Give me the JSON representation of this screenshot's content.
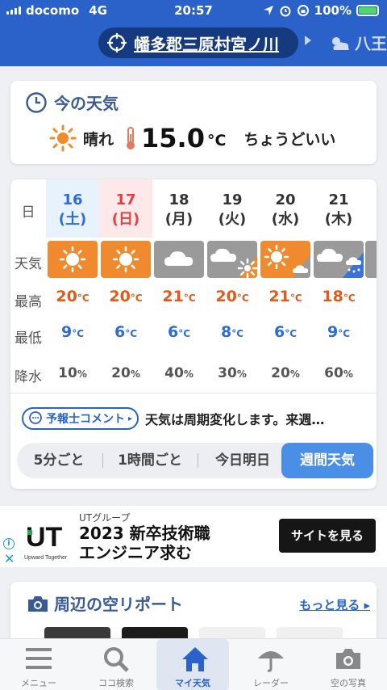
{
  "status": {
    "carrier": "docomo",
    "network": "4G",
    "time": "20:57",
    "battery": "100%"
  },
  "header": {
    "location": "幡多郡三原村宮ノ川",
    "next_location": "八王"
  },
  "now": {
    "title": "今の天気",
    "condition": "晴れ",
    "temp": "15.0",
    "unit": "°C",
    "feel": "ちょうどいい"
  },
  "week": {
    "row_labels": {
      "day": "日",
      "weather": "天気",
      "high": "最高",
      "low": "最低",
      "rain": "降水"
    },
    "days": [
      {
        "date": "16",
        "dow": "(土)",
        "weather": "sunny",
        "high": "20",
        "low": "9",
        "rain": "10"
      },
      {
        "date": "17",
        "dow": "(日)",
        "weather": "sunny",
        "high": "20",
        "low": "6",
        "rain": "20"
      },
      {
        "date": "18",
        "dow": "(月)",
        "weather": "cloudy",
        "high": "21",
        "low": "6",
        "rain": "40"
      },
      {
        "date": "19",
        "dow": "(火)",
        "weather": "cloudy-then-sunny",
        "high": "20",
        "low": "8",
        "rain": "30"
      },
      {
        "date": "20",
        "dow": "(水)",
        "weather": "sunny-then-cloudy",
        "high": "21",
        "low": "6",
        "rain": "20"
      },
      {
        "date": "21",
        "dow": "(木)",
        "weather": "cloudy-then-rain",
        "high": "18",
        "low": "9",
        "rain": "60"
      }
    ],
    "temp_unit": "°C",
    "rain_unit": "%",
    "comment_button": "予報士コメント",
    "comment_text": "天気は周期変化します。来週…",
    "tabs": [
      "5分ごと",
      "1時間ごと",
      "今日明日",
      "週間天気"
    ],
    "active_tab": "週間天気"
  },
  "ad": {
    "company": "UTグループ",
    "headline_line1": "2023 新卒技術職",
    "headline_line2": "エンジニア求む",
    "cta": "サイトを見る",
    "logo_text": "UT",
    "logo_sub": "Upward Together"
  },
  "sky": {
    "title": "周辺の空リポート",
    "more": "もっと見る"
  },
  "nav": [
    "メニュー",
    "ココ検索",
    "マイ天気",
    "レーダー",
    "空の写真"
  ],
  "colors": {
    "brand": "#2a62c9",
    "sunny_bg": "#ef8a2e",
    "cloudy_bg": "#9a9a9a",
    "high": "#e05a1c",
    "low": "#2f6cd6",
    "saturday": "#2f6cd6",
    "sunday": "#e04040"
  }
}
